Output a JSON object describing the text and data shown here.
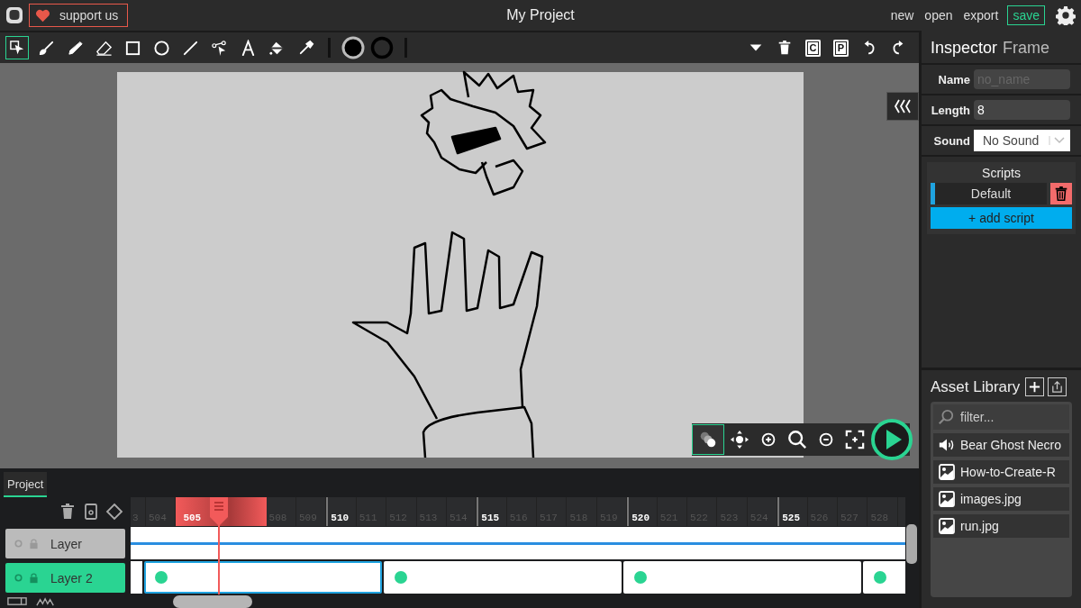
{
  "topbar": {
    "support": "support us",
    "title": "My Project",
    "menu": [
      {
        "label": "new",
        "kind": "link"
      },
      {
        "label": "open",
        "kind": "link"
      },
      {
        "label": "export",
        "kind": "link"
      },
      {
        "label": "save",
        "kind": "save"
      }
    ]
  },
  "tools": [
    {
      "kind": "select",
      "selected": true
    },
    {
      "kind": "brush",
      "selected": false
    },
    {
      "kind": "pencil",
      "selected": false
    },
    {
      "kind": "eraser",
      "selected": false
    },
    {
      "kind": "rectangle",
      "selected": false
    },
    {
      "kind": "ellipse",
      "selected": false
    },
    {
      "kind": "line",
      "selected": false
    },
    {
      "kind": "pathedit",
      "selected": false
    },
    {
      "kind": "text",
      "selected": false
    },
    {
      "kind": "fill",
      "selected": false
    },
    {
      "kind": "eyedropper",
      "selected": false
    }
  ],
  "actions": [
    {
      "kind": "menu"
    },
    {
      "kind": "delete"
    },
    {
      "kind": "copy",
      "glyph": "C"
    },
    {
      "kind": "paste",
      "glyph": "P"
    },
    {
      "kind": "undo"
    },
    {
      "kind": "redo"
    }
  ],
  "canvas_controls": [
    {
      "kind": "onion",
      "on": true
    },
    {
      "kind": "pan",
      "on": false
    },
    {
      "kind": "zoomin",
      "on": false
    },
    {
      "kind": "zoom",
      "on": false
    },
    {
      "kind": "zoomout",
      "on": false
    },
    {
      "kind": "fit",
      "on": false
    }
  ],
  "inspector": {
    "title": "Inspector",
    "subtitle": "Frame",
    "fields": [
      {
        "label": "Name",
        "kind": "text",
        "placeholder": "no_name"
      },
      {
        "label": "Length",
        "kind": "text",
        "value": "8"
      },
      {
        "label": "Sound",
        "kind": "select",
        "value": "No Sound"
      }
    ],
    "scripts": {
      "title": "Scripts",
      "items": [
        {
          "name": "Default",
          "selected": true
        }
      ],
      "add": "+ add script"
    }
  },
  "assets": {
    "title": "Asset Library",
    "filter": {
      "placeholder": "filter..."
    },
    "items": [
      {
        "name": "Bear Ghost Necro",
        "kind": "audio"
      },
      {
        "name": "How-to-Create-R",
        "kind": "image"
      },
      {
        "name": "images.jpg",
        "kind": "image"
      },
      {
        "name": "run.jpg",
        "kind": "image"
      }
    ]
  },
  "timeline": {
    "tab": "Project",
    "ruler": [
      {
        "label": "3",
        "kind": "partial"
      },
      {
        "label": "504",
        "kind": "tick"
      },
      {
        "label": "505",
        "kind": "range"
      },
      {
        "label": "508",
        "kind": "tick"
      },
      {
        "label": "509",
        "kind": "tick"
      },
      {
        "label": "510",
        "kind": "major"
      },
      {
        "label": "511",
        "kind": "tick"
      },
      {
        "label": "512",
        "kind": "tick"
      },
      {
        "label": "513",
        "kind": "tick"
      },
      {
        "label": "514",
        "kind": "tick"
      },
      {
        "label": "515",
        "kind": "major"
      },
      {
        "label": "516",
        "kind": "tick"
      },
      {
        "label": "517",
        "kind": "tick"
      },
      {
        "label": "518",
        "kind": "tick"
      },
      {
        "label": "519",
        "kind": "tick"
      },
      {
        "label": "520",
        "kind": "major"
      },
      {
        "label": "521",
        "kind": "tick"
      },
      {
        "label": "522",
        "kind": "tick"
      },
      {
        "label": "523",
        "kind": "tick"
      },
      {
        "label": "524",
        "kind": "tick"
      },
      {
        "label": "525",
        "kind": "major"
      },
      {
        "label": "526",
        "kind": "tick"
      },
      {
        "label": "527",
        "kind": "tick"
      },
      {
        "label": "528",
        "kind": "tick"
      }
    ],
    "layers": [
      {
        "name": "Layer",
        "selected": false,
        "kind": "line"
      },
      {
        "name": "Layer 2",
        "selected": true,
        "kind": "frames",
        "frames": [
          {
            "selected": true
          },
          {
            "selected": false
          },
          {
            "selected": false
          },
          {
            "selected": false
          }
        ]
      }
    ]
  }
}
